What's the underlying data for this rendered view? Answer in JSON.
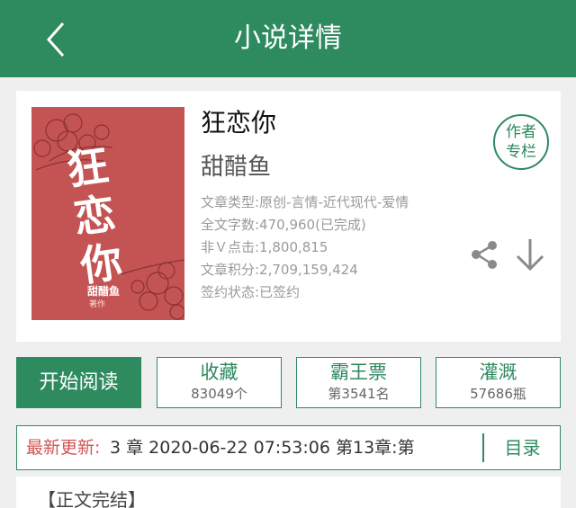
{
  "header": {
    "title": "小说详情",
    "back_icon": "chevron-left-icon",
    "background_color": "#2e8a5f"
  },
  "book": {
    "title": "狂恋你",
    "author": "甜醋鱼",
    "cover": {
      "title": "狂恋你",
      "author": "甜醋鱼",
      "subtitle": "著作"
    },
    "meta": [
      "文章类型:原创-言情-近代现代-爱情",
      "全文字数:470,960(已完成)",
      "非Ｖ点击:1,800,815",
      "文章积分:2,709,159,424",
      "签约状态:已签约"
    ],
    "author_column": [
      "作者",
      "专栏"
    ],
    "share_icon": "share-icon",
    "download_icon": "download-arrow-icon"
  },
  "actions": {
    "read_label": "开始阅读",
    "collect": {
      "label": "收藏",
      "value": "83049个"
    },
    "ticket": {
      "label": "霸王票",
      "value": "第3541名"
    },
    "water": {
      "label": "灌溉",
      "value": "57686瓶"
    }
  },
  "update": {
    "label": "最新更新:",
    "text": "3 章 2020-06-22 07:53:06  第13章:第",
    "toc_label": "目录"
  },
  "content": {
    "section_head": "【正文完结】"
  },
  "colors": {
    "accent": "#2e8a5f",
    "update_label": "#d25555",
    "cover": "#c45454",
    "page_bg": "#efefef"
  }
}
